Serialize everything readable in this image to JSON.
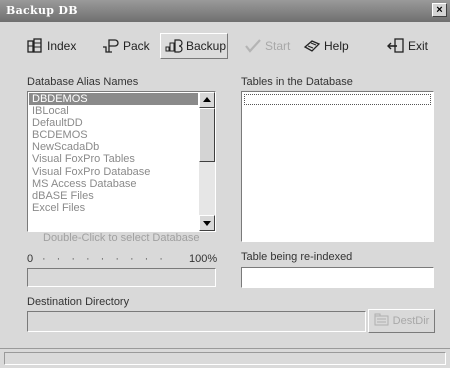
{
  "window": {
    "title": "Backup DB",
    "close_label": "×"
  },
  "toolbar": {
    "index_label": "Index",
    "pack_label": "Pack",
    "backup_label": "Backup",
    "start_label": "Start",
    "help_label": "Help",
    "exit_label": "Exit"
  },
  "aliases": {
    "label": "Database Alias Names",
    "items": [
      "DBDEMOS",
      "IBLocal",
      "DefaultDD",
      "BCDEMOS",
      "NewScadaDb",
      "Visual FoxPro Tables",
      "Visual FoxPro Database",
      "MS Access Database",
      "dBASE Files",
      "Excel Files"
    ],
    "selected": "DBDEMOS",
    "hint": "Double-Click to select Database"
  },
  "tables": {
    "label": "Tables in the Database",
    "items": []
  },
  "progress": {
    "start_label": "0",
    "end_label": "100%",
    "value": 0
  },
  "reindex": {
    "label": "Table being re-indexed",
    "value": ""
  },
  "destination": {
    "label": "Destination Directory",
    "value": "",
    "button_label": "DestDir"
  },
  "colors": {
    "title_bar": "#7f7f7f",
    "window_bg": "#d9d9d9",
    "selection": "#8a8a8a"
  }
}
